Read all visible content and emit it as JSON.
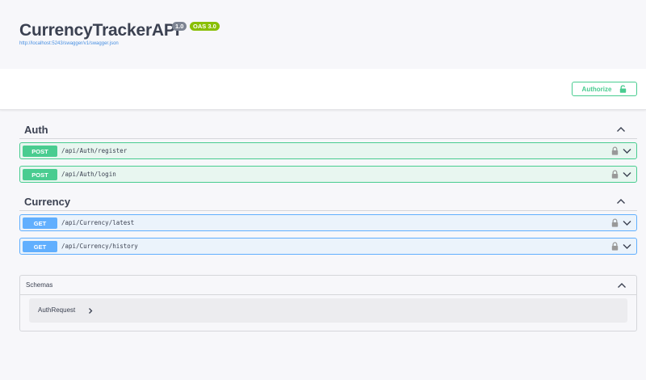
{
  "info": {
    "title": "CurrencyTrackerAPI",
    "version": "1.0",
    "oas": "OAS 3.0",
    "spec_url": "http://localhost:5243/swagger/v1/swagger.json"
  },
  "scheme": {
    "authorize_label": "Authorize"
  },
  "tags": [
    {
      "name": "Auth",
      "operations": [
        {
          "method": "POST",
          "path": "/api/Auth/register"
        },
        {
          "method": "POST",
          "path": "/api/Auth/login"
        }
      ]
    },
    {
      "name": "Currency",
      "operations": [
        {
          "method": "GET",
          "path": "/api/Currency/latest"
        },
        {
          "method": "GET",
          "path": "/api/Currency/history"
        }
      ]
    }
  ],
  "schemas": {
    "title": "Schemas",
    "items": [
      {
        "name": "AuthRequest"
      }
    ]
  },
  "colors": {
    "post": "#49cc90",
    "get": "#61affe",
    "link": "#4990e2",
    "version_badge": "#7d8492",
    "oas_badge": "#89bf04"
  },
  "icons": {
    "lock": "lock-icon",
    "chevron_down": "chevron-down-icon",
    "chevron_up": "chevron-up-icon",
    "chevron_right": "chevron-right-icon"
  }
}
